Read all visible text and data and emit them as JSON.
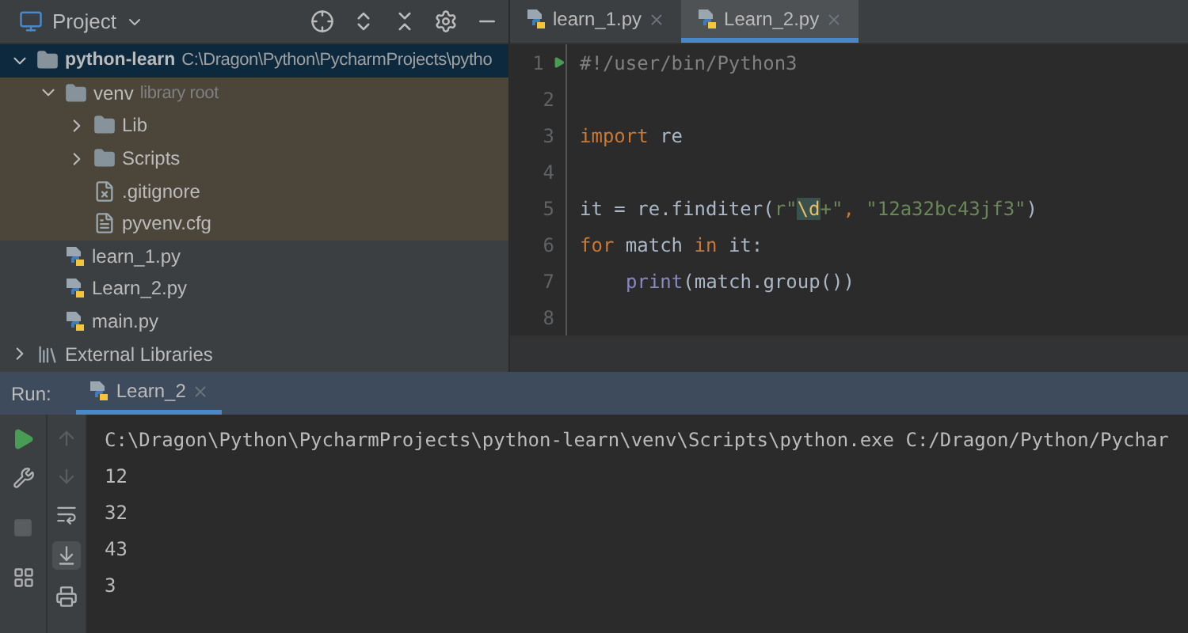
{
  "project_panel": {
    "title": "Project",
    "tree": [
      {
        "kind": "folder",
        "label": "python-learn",
        "hint": "C:\\Dragon\\Python\\PycharmProjects\\pytho",
        "bold": true,
        "expanded": true,
        "selected": true,
        "children": [
          {
            "kind": "folder",
            "label": "venv",
            "hint": "library root",
            "library": true,
            "expanded": true,
            "selected": false,
            "children": [
              {
                "kind": "folder",
                "label": "Lib",
                "expanded": false,
                "selected": false
              },
              {
                "kind": "folder",
                "label": "Scripts",
                "expanded": false,
                "selected": false
              },
              {
                "kind": "ignore",
                "label": ".gitignore",
                "selected": false
              },
              {
                "kind": "text",
                "label": "pyvenv.cfg",
                "selected": false
              }
            ]
          },
          {
            "kind": "python",
            "label": "learn_1.py",
            "selected": false
          },
          {
            "kind": "python",
            "label": "Learn_2.py",
            "selected": false
          },
          {
            "kind": "python",
            "label": "main.py",
            "selected": false
          }
        ]
      },
      {
        "kind": "libraries",
        "label": "External Libraries",
        "expanded": false,
        "selected": false
      }
    ]
  },
  "editor": {
    "tabs": [
      {
        "label": "learn_1.py",
        "selected": false
      },
      {
        "label": "Learn_2.py",
        "selected": true
      }
    ],
    "lines": [
      {
        "number": "1",
        "run_marker": true,
        "tokens": [
          {
            "kind": "comment",
            "text": "#!/user/bin/Python3"
          }
        ]
      },
      {
        "number": "2"
      },
      {
        "number": "3",
        "tokens": [
          {
            "kind": "keyword",
            "text": "import"
          },
          {
            "kind": "plain",
            "text": " re"
          }
        ]
      },
      {
        "number": "4"
      },
      {
        "number": "5",
        "tokens": [
          {
            "kind": "plain",
            "text": "it = re.finditer("
          },
          {
            "kind": "string",
            "text": "r\""
          },
          {
            "kind": "regex",
            "text": "\\d"
          },
          {
            "kind": "string",
            "text": "+\""
          },
          {
            "kind": "keyword",
            "text": ", "
          },
          {
            "kind": "string",
            "text": "\"12a32bc43jf3\""
          },
          {
            "kind": "plain",
            "text": ")"
          }
        ]
      },
      {
        "number": "6",
        "tokens": [
          {
            "kind": "keyword",
            "text": "for"
          },
          {
            "kind": "plain",
            "text": " match "
          },
          {
            "kind": "keyword",
            "text": "in"
          },
          {
            "kind": "plain",
            "text": " it:"
          }
        ]
      },
      {
        "number": "7",
        "indented": true,
        "tokens": [
          {
            "kind": "builtin",
            "text": "print"
          },
          {
            "kind": "plain",
            "text": "(match.group())"
          }
        ]
      },
      {
        "number": "8"
      }
    ]
  },
  "run_panel": {
    "label": "Run:",
    "tabs": [
      {
        "label": "Learn_2",
        "selected": true
      }
    ],
    "output": [
      "C:\\Dragon\\Python\\PycharmProjects\\python-learn\\venv\\Scripts\\python.exe C:/Dragon/Python/Pychar",
      "12",
      "32",
      "43",
      "3"
    ]
  }
}
